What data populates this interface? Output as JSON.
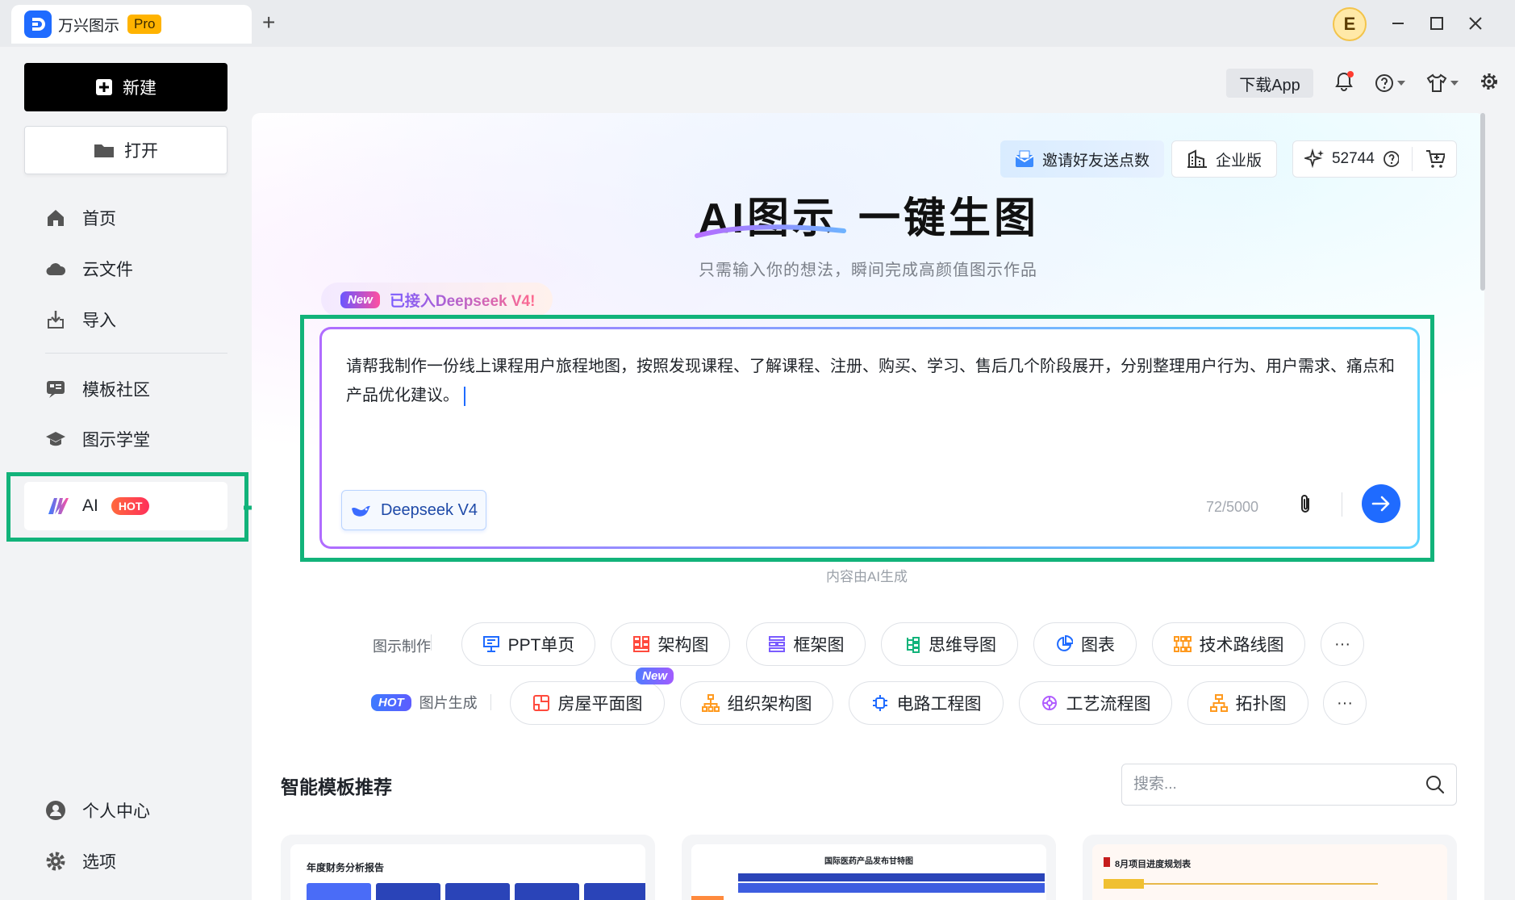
{
  "window": {
    "app_title": "万兴图示",
    "plan_badge": "Pro",
    "new_tab_symbol": "+",
    "avatar_letter": "E"
  },
  "sidebar": {
    "new_label": "新建",
    "open_label": "打开",
    "items": [
      {
        "label": "首页",
        "icon": "home-icon"
      },
      {
        "label": "云文件",
        "icon": "cloud-icon"
      },
      {
        "label": "导入",
        "icon": "import-icon"
      },
      {
        "label": "模板社区",
        "icon": "template-community-icon"
      },
      {
        "label": "图示学堂",
        "icon": "graduation-cap-icon"
      }
    ],
    "ai_label": "AI",
    "ai_badge": "HOT",
    "bottom_items": [
      {
        "label": "个人中心",
        "icon": "user-icon"
      },
      {
        "label": "选项",
        "icon": "gear-icon"
      }
    ]
  },
  "topbar": {
    "download_app": "下载App"
  },
  "promo": {
    "invite": "邀请好友送点数",
    "enterprise": "企业版",
    "points": "52744"
  },
  "hero": {
    "title_ai": "AI图示",
    "title_rest": "一键生图",
    "subtitle": "只需输入你的想法，瞬间完成高颜值图示作品",
    "new_badge": "New",
    "new_text": "已接入Deepseek V4!"
  },
  "prompt": {
    "text": "请帮我制作一份线上课程用户旅程地图，按照发现课程、了解课程、注册、购买、学习、售后几个阶段展开，分别整理用户行为、用户需求、痛点和产品优化建议。",
    "model": "Deepseek V4",
    "counter": "72/5000",
    "disclaimer": "内容由AI生成"
  },
  "diagram_row": {
    "label": "图示制作",
    "chips": [
      "PPT单页",
      "架构图",
      "框架图",
      "思维导图",
      "图表",
      "技术路线图"
    ],
    "more": "···"
  },
  "image_row": {
    "badge": "HOT",
    "label": "图片生成",
    "chips": [
      "房屋平面图",
      "组织架构图",
      "电路工程图",
      "工艺流程图",
      "拓扑图"
    ],
    "chip_new_badge": "New",
    "more": "···"
  },
  "templates": {
    "title": "智能模板推荐",
    "search_placeholder": "搜索...",
    "cards": [
      {
        "title": "年度财务分析报告"
      },
      {
        "title": "国际医药产品发布甘特图"
      },
      {
        "title": "8月项目进度规划表"
      }
    ]
  },
  "colors": {
    "accent": "#1f6bff",
    "highlight_green": "#12b37a",
    "hot": "#ff4a3d"
  }
}
